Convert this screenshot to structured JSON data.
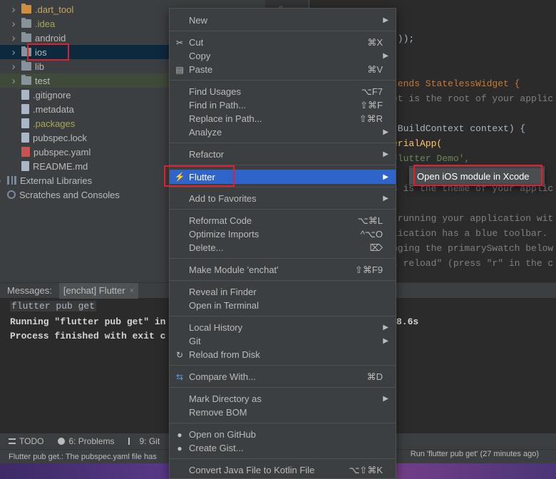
{
  "tree": {
    "items": [
      {
        "label": ".dart_tool",
        "type": "folder",
        "style": "orange",
        "expander": true
      },
      {
        "label": ".idea",
        "type": "folder",
        "style": "olive",
        "expander": true
      },
      {
        "label": "android",
        "type": "folder",
        "style": "normal",
        "expander": true
      },
      {
        "label": "ios",
        "type": "folder",
        "style": "normal",
        "expander": true,
        "selected": true
      },
      {
        "label": "lib",
        "type": "folder",
        "style": "normal",
        "expander": true
      },
      {
        "label": "test",
        "type": "folder",
        "style": "normal",
        "expander": true
      },
      {
        "label": ".gitignore",
        "type": "file",
        "style": "normal"
      },
      {
        "label": ".metadata",
        "type": "file",
        "style": "normal"
      },
      {
        "label": ".packages",
        "type": "file",
        "style": "olive"
      },
      {
        "label": "pubspec.lock",
        "type": "file",
        "style": "normal"
      },
      {
        "label": "pubspec.yaml",
        "type": "yaml",
        "style": "normal"
      },
      {
        "label": "README.md",
        "type": "file",
        "style": "normal"
      },
      {
        "label": "External Libraries",
        "type": "library",
        "style": "normal",
        "expander": true
      },
      {
        "label": "Scratches and Consoles",
        "type": "scratch",
        "style": "normal"
      }
    ]
  },
  "editor": {
    "gutter_number": "2",
    "lines": [
      {
        "text": "());"
      },
      {
        "text": "tends StatelessWidget {"
      },
      {
        "text": "et is the root of your applic"
      },
      {
        "text": "(BuildContext context) {"
      },
      {
        "text": "erialApp("
      },
      {
        "text": "Flutter Demo',"
      },
      {
        "text": "s is the theme of your applic"
      },
      {
        "text": " running your application wit"
      },
      {
        "text": "lication has a blue toolbar. "
      },
      {
        "text": "nging the primarySwatch below"
      },
      {
        "text": "t reload\" (press \"r\" in the c"
      }
    ]
  },
  "messages": {
    "label": "Messages:",
    "tab": "[enchat] Flutter",
    "close": "×",
    "console": [
      "flutter pub get",
      "Running \"flutter pub get\" in",
      "8.6s",
      "Process finished with exit c"
    ]
  },
  "bottom_bar": {
    "todo": "TODO",
    "problems": "6: Problems",
    "git": "9: Git"
  },
  "status": {
    "left": "Flutter pub get.: The pubspec.yaml file has",
    "right": "Run 'flutter pub get' (27 minutes ago)"
  },
  "context_menu": {
    "items": [
      {
        "label": "New",
        "submenu": true
      },
      {
        "sep": true
      },
      {
        "label": "Cut",
        "shortcut": "⌘X",
        "icon": "cut-icon",
        "glyph": "✂"
      },
      {
        "label": "Copy",
        "submenu": true
      },
      {
        "label": "Paste",
        "shortcut": "⌘V",
        "icon": "paste-icon",
        "glyph": "▤"
      },
      {
        "sep": true
      },
      {
        "label": "Find Usages",
        "shortcut": "⌥F7"
      },
      {
        "label": "Find in Path...",
        "shortcut": "⇧⌘F"
      },
      {
        "label": "Replace in Path...",
        "shortcut": "⇧⌘R"
      },
      {
        "label": "Analyze",
        "submenu": true
      },
      {
        "sep": true
      },
      {
        "label": "Refactor",
        "submenu": true
      },
      {
        "sep": true
      },
      {
        "label": "Flutter",
        "submenu": true,
        "active": true,
        "icon": "flutter-icon",
        "glyph": "⚡"
      },
      {
        "sep": true
      },
      {
        "label": "Add to Favorites",
        "submenu": true
      },
      {
        "sep": true
      },
      {
        "label": "Reformat Code",
        "shortcut": "⌥⌘L"
      },
      {
        "label": "Optimize Imports",
        "shortcut": "^⌥O"
      },
      {
        "label": "Delete...",
        "shortcut": "⌦"
      },
      {
        "sep": true
      },
      {
        "label": "Make Module 'enchat'",
        "shortcut": "⇧⌘F9"
      },
      {
        "sep": true
      },
      {
        "label": "Reveal in Finder"
      },
      {
        "label": "Open in Terminal"
      },
      {
        "sep": true
      },
      {
        "label": "Local History",
        "submenu": true
      },
      {
        "label": "Git",
        "submenu": true
      },
      {
        "label": "Reload from Disk",
        "icon": "reload-icon",
        "glyph": "↻"
      },
      {
        "sep": true
      },
      {
        "label": "Compare With...",
        "shortcut": "⌘D",
        "icon": "compare-icon",
        "glyph": "⇆"
      },
      {
        "sep": true
      },
      {
        "label": "Mark Directory as",
        "submenu": true
      },
      {
        "label": "Remove BOM"
      },
      {
        "sep": true
      },
      {
        "label": "Open on GitHub",
        "icon": "github-icon",
        "glyph": "●"
      },
      {
        "label": "Create Gist...",
        "icon": "github-gist-icon",
        "glyph": "●"
      },
      {
        "sep": true
      },
      {
        "label": "Convert Java File to Kotlin File",
        "shortcut": "⌥⇧⌘K"
      }
    ]
  },
  "submenu": {
    "item": "Open iOS module in Xcode"
  },
  "colors": {
    "highlight": "#e0202e",
    "menu_active": "#2f65ca"
  }
}
